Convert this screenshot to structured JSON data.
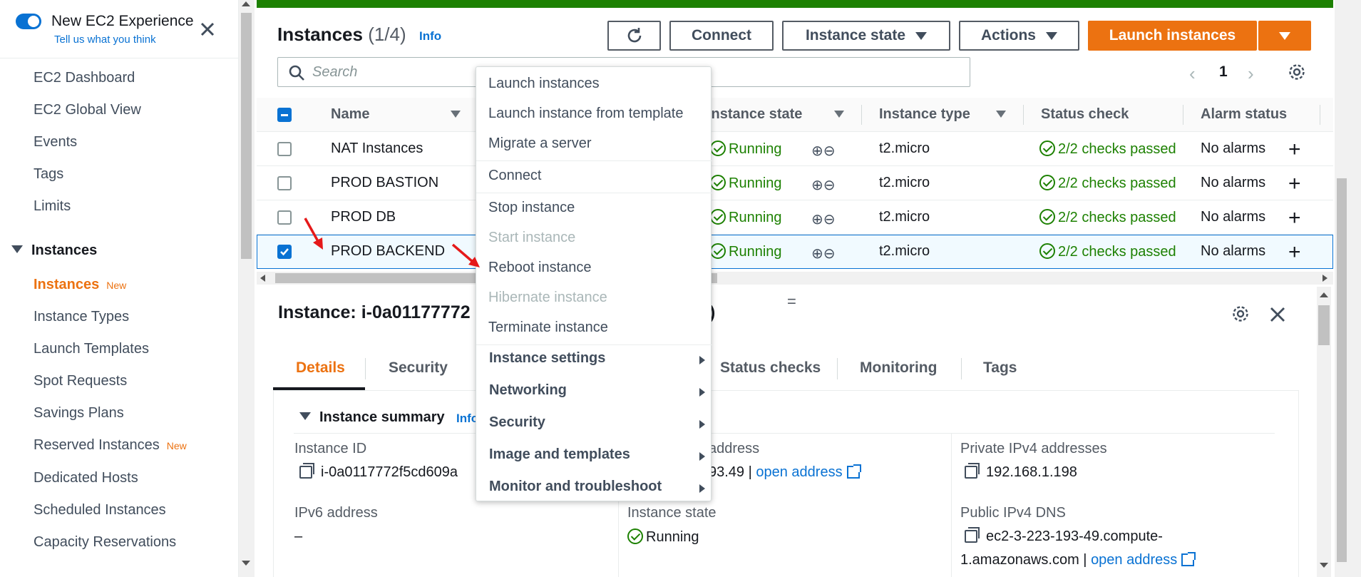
{
  "sidebar": {
    "experience_title": "New EC2 Experience",
    "experience_sub": "Tell us what you think",
    "items": [
      {
        "label": "EC2 Dashboard"
      },
      {
        "label": "EC2 Global View"
      },
      {
        "label": "Events"
      },
      {
        "label": "Tags"
      },
      {
        "label": "Limits"
      }
    ],
    "section": "Instances",
    "section_items": [
      {
        "label": "Instances",
        "badge": "New",
        "active": true
      },
      {
        "label": "Instance Types"
      },
      {
        "label": "Launch Templates"
      },
      {
        "label": "Spot Requests"
      },
      {
        "label": "Savings Plans"
      },
      {
        "label": "Reserved Instances",
        "badge": "New"
      },
      {
        "label": "Dedicated Hosts"
      },
      {
        "label": "Scheduled Instances"
      },
      {
        "label": "Capacity Reservations"
      }
    ]
  },
  "header": {
    "title": "Instances",
    "count": "(1/4)",
    "info": "Info",
    "buttons": {
      "connect": "Connect",
      "instance_state": "Instance state",
      "actions": "Actions",
      "launch": "Launch instances"
    },
    "search_placeholder": "Search",
    "page": "1"
  },
  "table": {
    "columns": [
      "Name",
      "Instance state",
      "Instance type",
      "Status check",
      "Alarm status"
    ],
    "rows": [
      {
        "name": "NAT Instances",
        "state": "Running",
        "type": "t2.micro",
        "status": "2/2 checks passed",
        "alarm": "No alarms",
        "selected": false
      },
      {
        "name": "PROD BASTION",
        "state": "Running",
        "type": "t2.micro",
        "status": "2/2 checks passed",
        "alarm": "No alarms",
        "selected": false
      },
      {
        "name": "PROD DB",
        "state": "Running",
        "type": "t2.micro",
        "status": "2/2 checks passed",
        "alarm": "No alarms",
        "selected": false
      },
      {
        "name": "PROD BACKEND",
        "state": "Running",
        "type": "t2.micro",
        "status": "2/2 checks passed",
        "alarm": "No alarms",
        "selected": true
      }
    ]
  },
  "details": {
    "title_head": "Instance: i-0a01177772",
    "title_tail": "D)",
    "tabs": [
      "Details",
      "Security",
      "Status checks",
      "Monitoring",
      "Tags"
    ],
    "active_tab": "Details",
    "summary_title": "Instance summary",
    "summary_info": "Info",
    "fields": {
      "instance_id_label": "Instance ID",
      "instance_id_value": "i-0a0117772f5cd609a",
      "public_ip_label": "address",
      "public_ip_value": "93.49 |",
      "public_ip_link": "open address",
      "private_ip_label": "Private IPv4 addresses",
      "private_ip_value": "192.168.1.198",
      "ipv6_label": "IPv6 address",
      "ipv6_value": "–",
      "state_label": "Instance state",
      "state_value": "Running",
      "public_dns_label": "Public IPv4 DNS",
      "public_dns_value_1": "ec2-3-223-193-49.compute-",
      "public_dns_value_2": "1.amazonaws.com |",
      "public_dns_link": "open address"
    }
  },
  "menu": {
    "items": [
      {
        "label": "Launch instances",
        "disabled": false
      },
      {
        "label": "Launch instance from template",
        "disabled": false
      },
      {
        "label": "Migrate a server",
        "disabled": false
      },
      {
        "label": "Connect",
        "disabled": false
      },
      {
        "label": "Stop instance",
        "disabled": false
      },
      {
        "label": "Start instance",
        "disabled": true
      },
      {
        "label": "Reboot instance",
        "disabled": false
      },
      {
        "label": "Hibernate instance",
        "disabled": true
      },
      {
        "label": "Terminate instance",
        "disabled": false
      },
      {
        "label": "Instance settings",
        "submenu": true
      },
      {
        "label": "Networking",
        "submenu": true
      },
      {
        "label": "Security",
        "submenu": true
      },
      {
        "label": "Image and templates",
        "submenu": true
      },
      {
        "label": "Monitor and troubleshoot",
        "submenu": true
      }
    ]
  },
  "colors": {
    "accent": "#ec7211",
    "link": "#0972d3",
    "success": "#1d8102",
    "annotation": "#e5191a"
  }
}
